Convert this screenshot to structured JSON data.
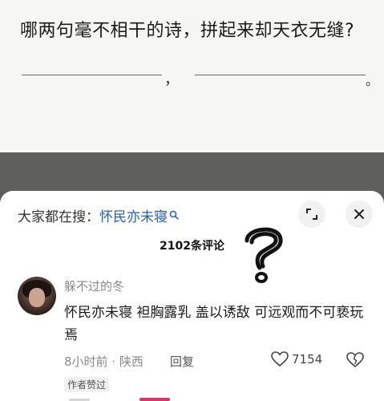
{
  "question": {
    "text": "哪两句毫不相干的诗，拼起来却天衣无缝?",
    "comma": "，",
    "period": "。"
  },
  "search": {
    "prefix": "大家都在搜：",
    "term": "怀民亦未寝"
  },
  "comments": {
    "count_label": "2102条评论",
    "item": {
      "username": "躲不过的冬",
      "text": "怀民亦未寝 袒胸露乳 盖以诱敌 可远观而不可亵玩焉",
      "meta": "8小时前 · 陕西",
      "reply_label": "回复",
      "likes": "7154",
      "badge": "作者赞过"
    }
  },
  "colors": {
    "search_term": "#1f5fc4",
    "accent_pink": "#ef2a68"
  }
}
